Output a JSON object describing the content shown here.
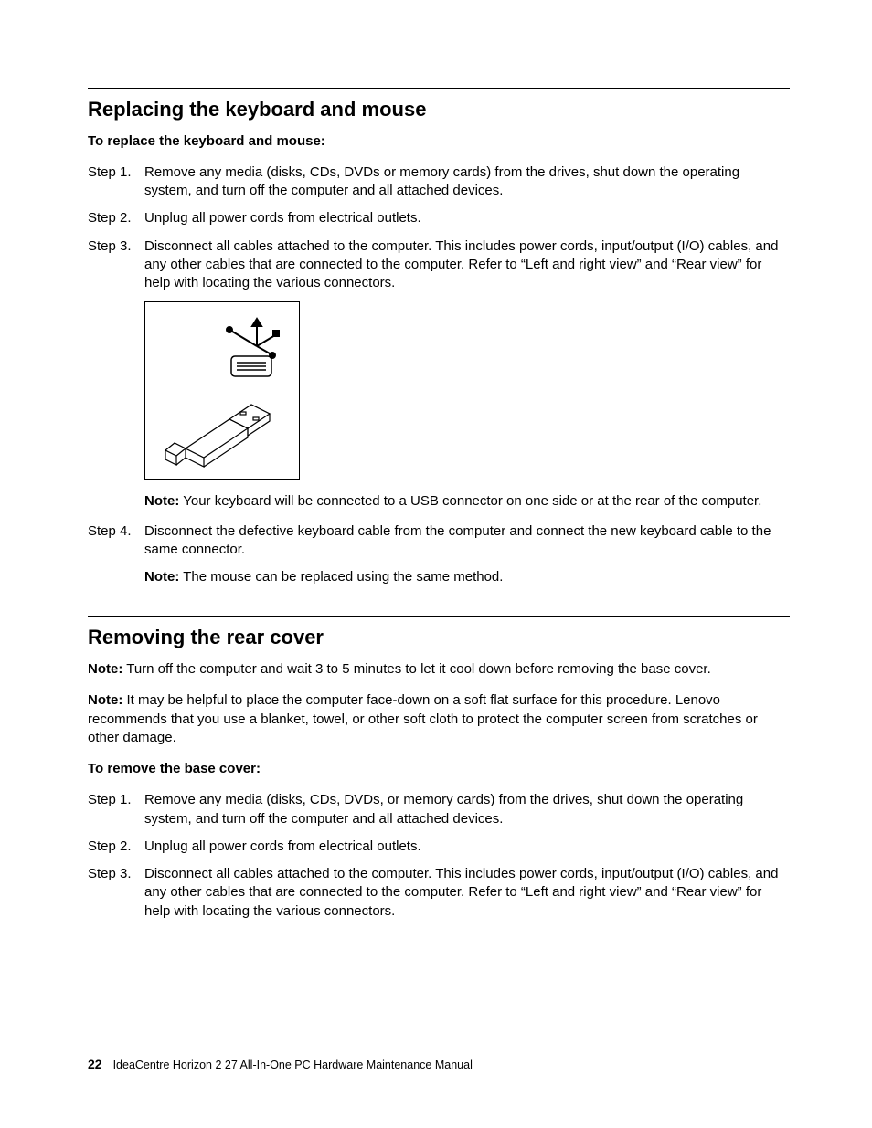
{
  "section1": {
    "heading": "Replacing the keyboard and mouse",
    "subhead": "To replace the keyboard and mouse:",
    "steps": [
      {
        "label": "Step 1.",
        "text": "Remove any media (disks, CDs, DVDs or memory cards) from the drives, shut down the operating system, and turn off the computer and all attached devices."
      },
      {
        "label": "Step 2.",
        "text": "Unplug all power cords from electrical outlets."
      },
      {
        "label": "Step 3.",
        "text": "Disconnect all cables attached to the computer. This includes power cords, input/output (I/O) cables, and any other cables that are connected to the computer. Refer to “Left and right view” and “Rear view” for help with locating the various connectors."
      }
    ],
    "note1": {
      "prefix": "Note:",
      "text": " Your keyboard will be connected to a USB connector on one side or at the rear of the computer."
    },
    "step4": {
      "label": "Step 4.",
      "text": "Disconnect the defective keyboard cable from the computer and connect the new keyboard cable to the same connector."
    },
    "note2": {
      "prefix": "Note:",
      "text": " The mouse can be replaced using the same method."
    }
  },
  "section2": {
    "heading": "Removing the rear cover",
    "note1": {
      "prefix": "Note:",
      "text": " Turn off the computer and wait 3 to 5 minutes to let it cool down before removing the base cover."
    },
    "note2": {
      "prefix": "Note:",
      "text": " It may be helpful to place the computer face-down on a soft flat surface for this procedure. Lenovo recommends that you use a blanket, towel, or other soft cloth to protect the computer screen from scratches or other damage."
    },
    "subhead": "To remove the base cover:",
    "steps": [
      {
        "label": "Step 1.",
        "text": "Remove any media (disks, CDs, DVDs, or memory cards) from the drives, shut down the operating system, and turn off the computer and all attached devices."
      },
      {
        "label": "Step 2.",
        "text": "Unplug all power cords from electrical outlets."
      },
      {
        "label": "Step 3.",
        "text": "Disconnect all cables attached to the computer. This includes power cords, input/output (I/O) cables, and any other cables that are connected to the computer. Refer to “Left and right view” and “Rear view” for help with locating the various connectors."
      }
    ]
  },
  "footer": {
    "page": "22",
    "title": "IdeaCentre Horizon 2 27 All-In-One PC Hardware Maintenance Manual"
  }
}
